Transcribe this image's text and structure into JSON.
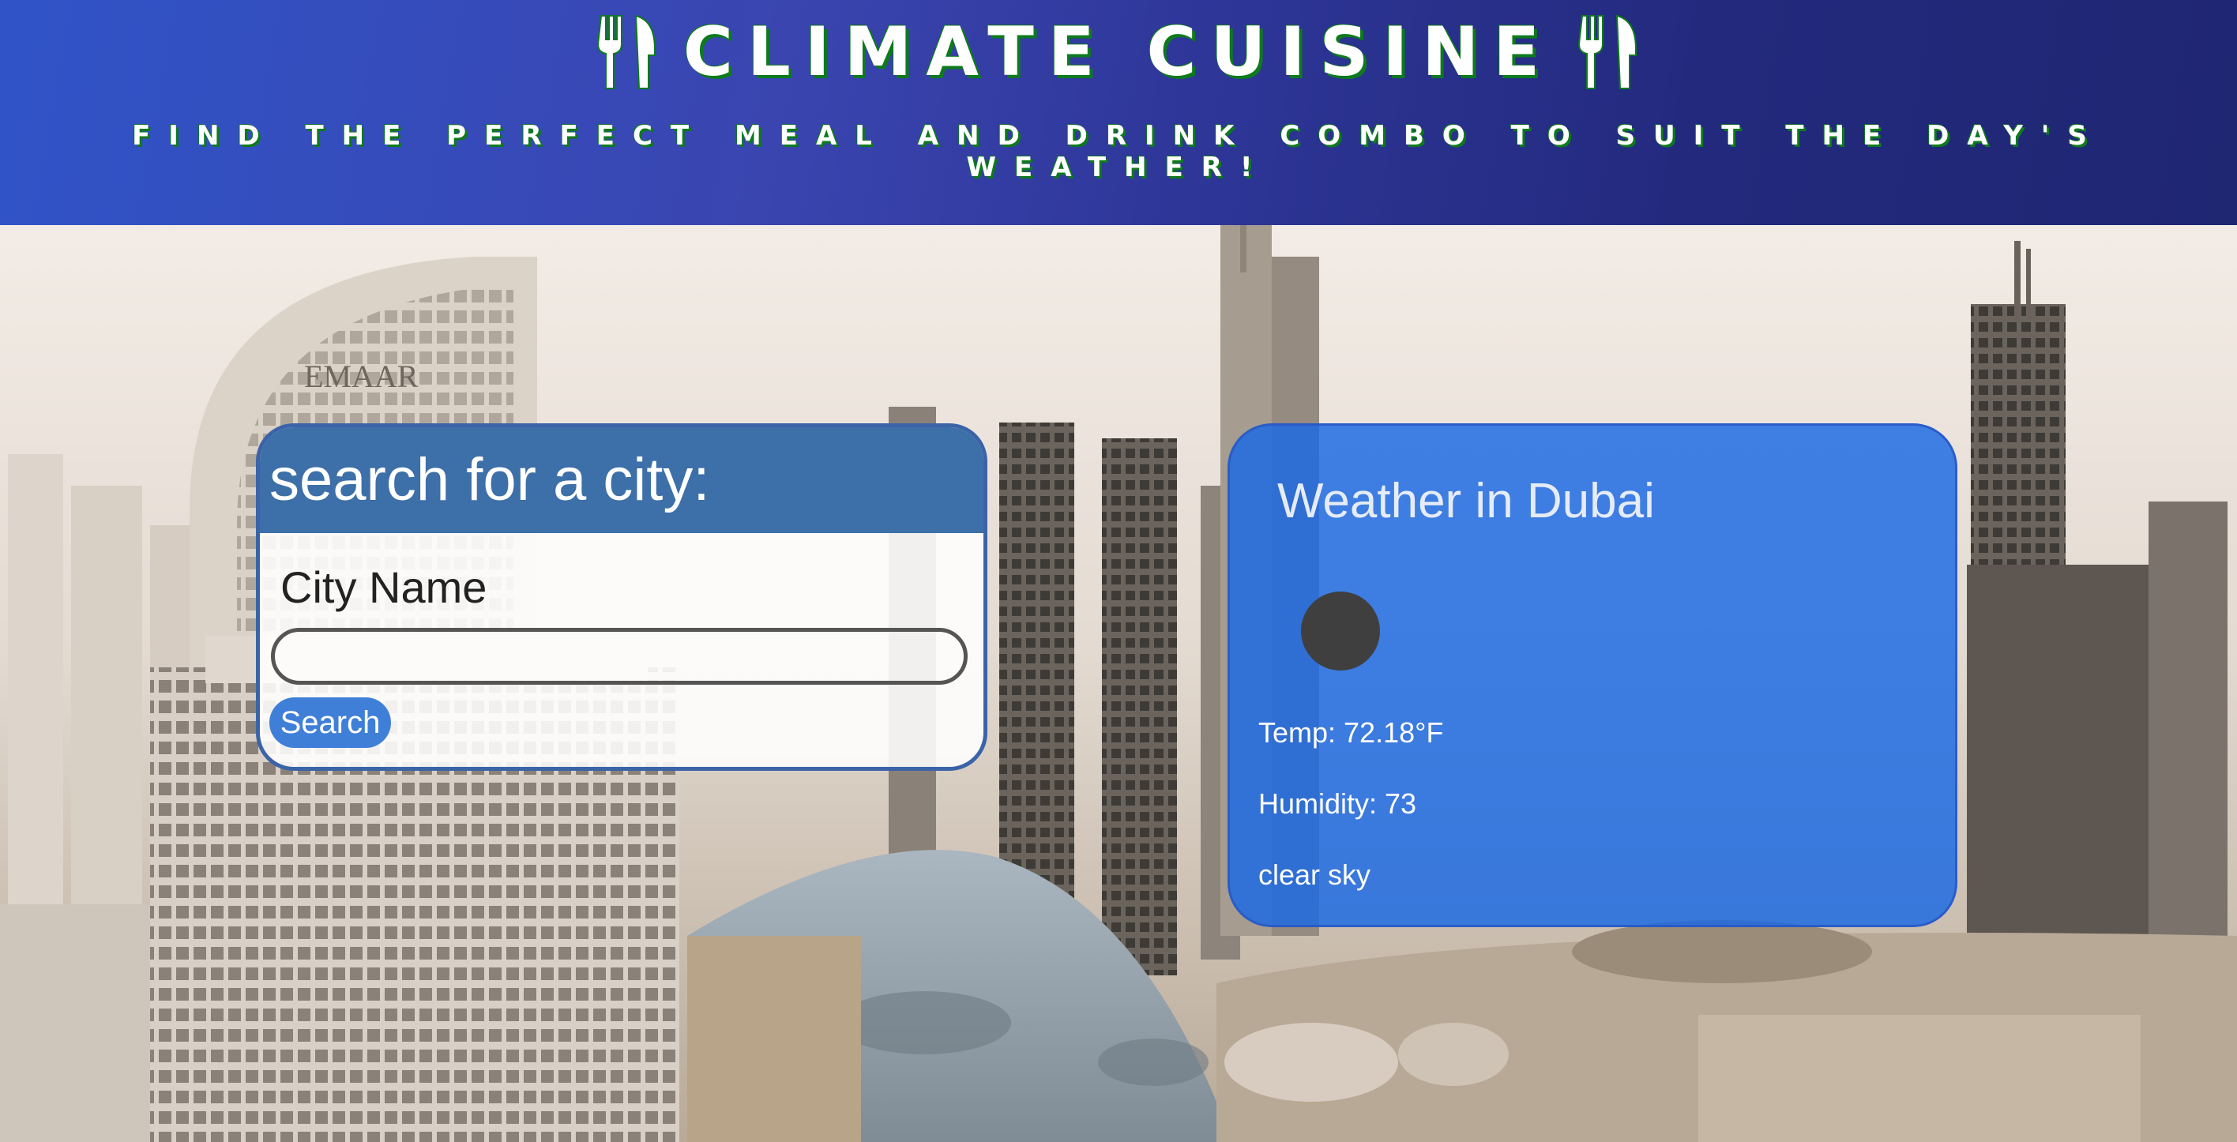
{
  "header": {
    "title": "CLIMATE CUISINE",
    "tagline": "FIND THE PERFECT MEAL AND DRINK COMBO TO SUIT THE DAY'S WEATHER!",
    "left_icon": "fork-knife-icon",
    "right_icon": "fork-knife-icon"
  },
  "background": {
    "billboard_text": "EMAAR"
  },
  "search": {
    "title": "search for a city:",
    "city_label": "City Name",
    "input_value": "",
    "input_placeholder": "",
    "button_label": "Search"
  },
  "weather": {
    "title": "Weather in Dubai",
    "icon": "weather-icon",
    "temp": "Temp: 72.18°F",
    "humidity": "Humidity: 73",
    "description": "clear sky"
  },
  "colors": {
    "header_start": "#3054c8",
    "header_end": "#1f2672",
    "title_shadow": "#0e7a1c",
    "search_header": "#3d6fa8",
    "search_button": "#3f7fd8",
    "weather_card": "#1868e4"
  }
}
